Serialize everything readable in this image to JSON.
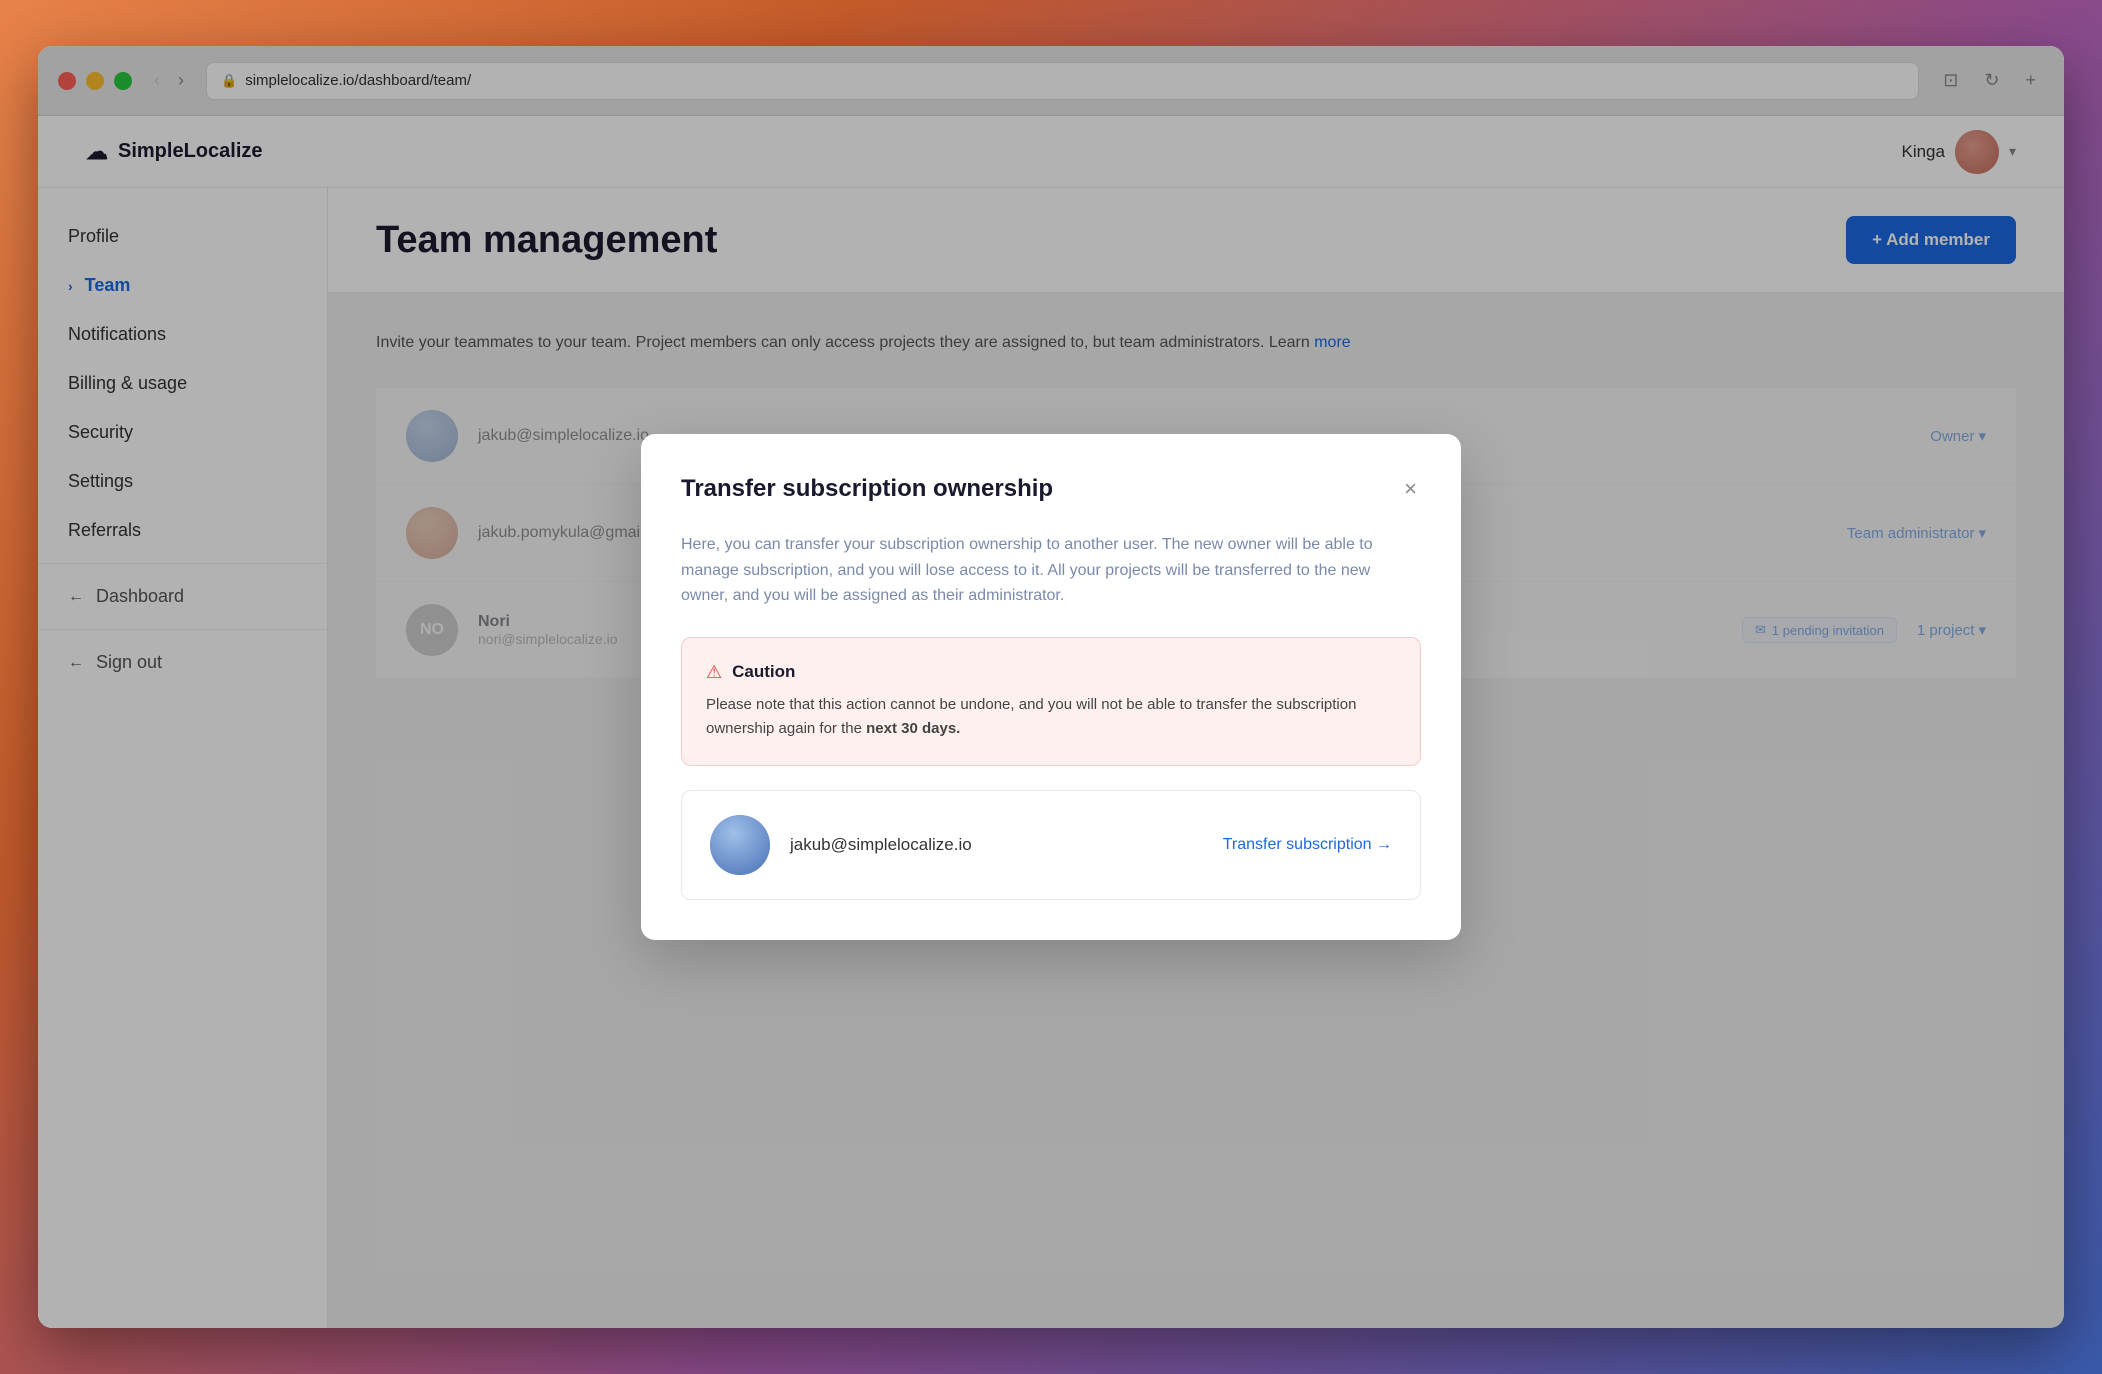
{
  "browser": {
    "url": "simplelocalize.io/dashboard/team/",
    "back_disabled": true,
    "forward_disabled": false,
    "new_tab_label": "+"
  },
  "app": {
    "brand": {
      "name": "SimpleLocalize",
      "icon": "☁"
    },
    "user": {
      "name": "Kinga",
      "avatar_alt": "Kinga avatar"
    }
  },
  "sidebar": {
    "nav_items": [
      {
        "id": "profile",
        "label": "Profile",
        "active": false,
        "prefix": ""
      },
      {
        "id": "team",
        "label": "Team",
        "active": true,
        "prefix": "›"
      },
      {
        "id": "notifications",
        "label": "Notifications",
        "active": false,
        "prefix": ""
      },
      {
        "id": "billing",
        "label": "Billing & usage",
        "active": false,
        "prefix": ""
      },
      {
        "id": "security",
        "label": "Security",
        "active": false,
        "prefix": ""
      },
      {
        "id": "settings",
        "label": "Settings",
        "active": false,
        "prefix": ""
      },
      {
        "id": "referrals",
        "label": "Referrals",
        "active": false,
        "prefix": ""
      }
    ],
    "secondary_items": [
      {
        "id": "dashboard",
        "label": "Dashboard",
        "prefix": "←"
      },
      {
        "id": "signout",
        "label": "Sign out",
        "prefix": "←"
      }
    ]
  },
  "main": {
    "page_title": "Team management",
    "add_member_button": "+ Add member",
    "description": "Invite your teammates to your team. Project members can only access projects they are assigned to, but team administrators. Learn",
    "team_members": [
      {
        "id": "owner",
        "initials": "",
        "email": "jakub@simplelocalize.io",
        "role": "Owner",
        "has_avatar": true,
        "avatar_color": "#8ab0e0"
      },
      {
        "id": "admin",
        "initials": "",
        "email": "jakub.pomykula@gmail.com",
        "role": "Team administrator",
        "has_avatar": true,
        "avatar_color": "#c47a50"
      },
      {
        "id": "nori",
        "initials": "NO",
        "name": "Nori",
        "email": "nori@simplelocalize.io",
        "role": "",
        "pending": "1 pending invitation",
        "projects": "1 project",
        "has_avatar": false,
        "avatar_color": "#888888"
      }
    ]
  },
  "modal": {
    "title": "Transfer subscription ownership",
    "close_label": "×",
    "description": "Here, you can transfer your subscription ownership to another user. The new owner will be able to manage subscription, and you will lose access to it. All your projects will be transferred to the new owner, and you will be assigned as their administrator.",
    "caution": {
      "icon": "⚠",
      "title": "Caution",
      "text": "Please note that this action cannot be undone, and you will not be able to transfer the subscription ownership again for the ",
      "bold_text": "next 30 days.",
      "suffix": ""
    },
    "transfer_user": {
      "email": "jakub@simplelocalize.io",
      "avatar_alt": "jakub avatar"
    },
    "transfer_button": "Transfer subscription →"
  },
  "colors": {
    "accent": "#1a6ae4",
    "caution_bg": "#fff0f0",
    "caution_border": "#f8c8c8",
    "caution_icon": "#e04040"
  }
}
